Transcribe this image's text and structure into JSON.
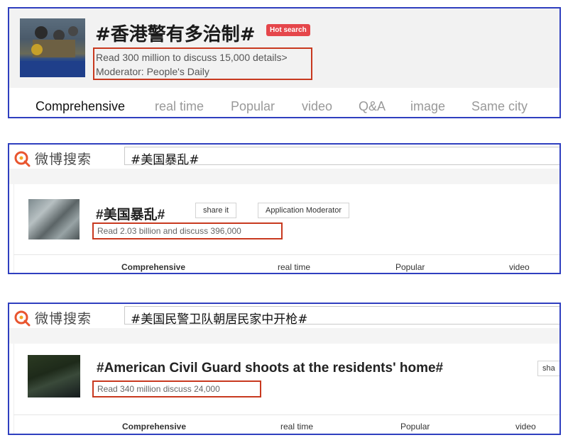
{
  "panel1": {
    "title": "#香港警有多治制#",
    "badge": "Hot search",
    "info_line1": "Read 300 million to discuss 15,000 details>",
    "info_line2": "Moderator: People's Daily",
    "tabs": [
      "Comprehensive",
      "real time",
      "Popular",
      "video",
      "Q&A",
      "image",
      "Same city"
    ]
  },
  "panel2": {
    "logo_text": "微博搜索",
    "search_query": "#美国暴乱#",
    "topic": "#美国暴乱#",
    "share_button": "share it",
    "moderator_button": "Application Moderator",
    "info": "Read 2.03 billion and    discuss 396,000",
    "tabs": [
      "Comprehensive",
      "real time",
      "Popular",
      "video"
    ]
  },
  "panel3": {
    "logo_text": "微博搜索",
    "search_query": "#美国民警卫队朝居民家中开枪#",
    "topic": "#American Civil Guard shoots at the residents' home#",
    "share_button": "sha",
    "info": "Read 340 million    discuss 24,000",
    "tabs": [
      "Comprehensive",
      "real time",
      "Popular",
      "video"
    ]
  },
  "colors": {
    "panel_border": "#2f3fbf",
    "highlight_box": "#c8391f",
    "hot_badge": "#e5464b",
    "weibo_logo": "#e8552f"
  },
  "icons": {
    "weibo_search_logo": "magnifier-logo-icon"
  }
}
